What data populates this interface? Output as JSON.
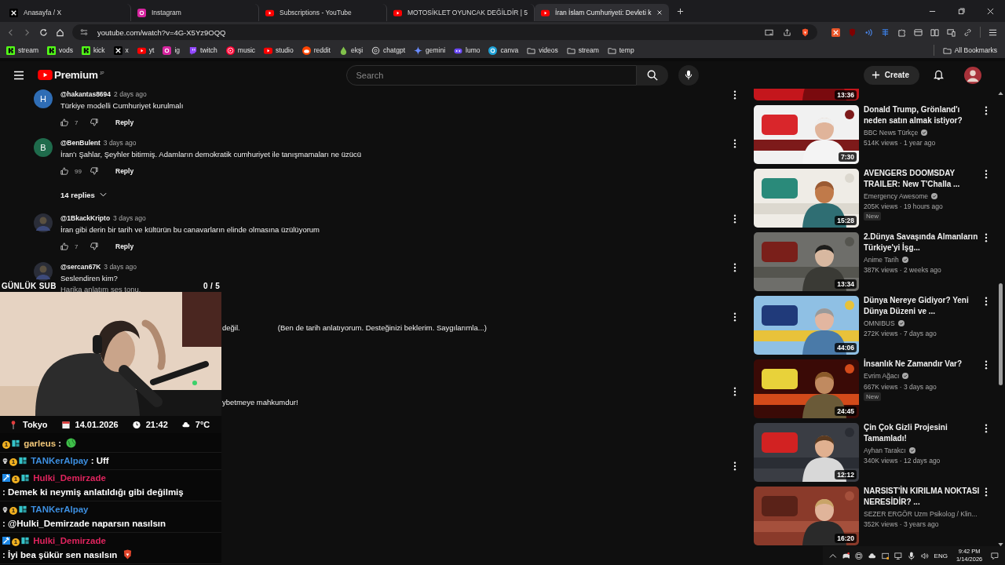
{
  "browser": {
    "tabs": [
      {
        "title": "Anasayfa / X",
        "kind": "x",
        "selected": false
      },
      {
        "title": "Instagram",
        "kind": "instagram",
        "selected": false
      },
      {
        "title": "Subscriptions - YouTube",
        "kind": "youtube",
        "selected": false
      },
      {
        "title": "MOTOSİKLET OYUNCAK DEĞİLDİR | 5",
        "kind": "youtube",
        "selected": false
      },
      {
        "title": "İran İslam Cumhuriyeti: Devleti k",
        "kind": "youtube",
        "selected": true
      }
    ],
    "address": "youtube.com/watch?v=4G-X5Yz9OQQ",
    "bookmarks": [
      {
        "label": "stream",
        "kind": "kick"
      },
      {
        "label": "vods",
        "kind": "kick"
      },
      {
        "label": "kick",
        "kind": "kick"
      },
      {
        "label": "x",
        "kind": "x"
      },
      {
        "label": "yt",
        "kind": "youtube"
      },
      {
        "label": "ig",
        "kind": "instagram"
      },
      {
        "label": "twitch",
        "kind": "twitch"
      },
      {
        "label": "music",
        "kind": "ytmusic"
      },
      {
        "label": "studio",
        "kind": "youtube"
      },
      {
        "label": "reddit",
        "kind": "reddit"
      },
      {
        "label": "ekşi",
        "kind": "drop"
      },
      {
        "label": "chatgpt",
        "kind": "openai"
      },
      {
        "label": "gemini",
        "kind": "gemini"
      },
      {
        "label": "lumo",
        "kind": "lumo"
      },
      {
        "label": "canva",
        "kind": "canva"
      },
      {
        "label": "videos",
        "kind": "folder"
      },
      {
        "label": "stream",
        "kind": "folder"
      },
      {
        "label": "temp",
        "kind": "folder"
      }
    ],
    "all_bookmarks": "All Bookmarks"
  },
  "header": {
    "logo": "Premium",
    "region": "JP",
    "search_placeholder": "Search",
    "create": "Create"
  },
  "comments": [
    {
      "kind": "comment",
      "avatar": {
        "kind": "letter",
        "letter": "H",
        "color": "#2f6db5"
      },
      "author": "@hakantas8694",
      "time": "2 days ago",
      "lines": [
        "Türkiye modelli Cumhuriyet kurulmalı"
      ],
      "likes": "7",
      "reply": "Reply"
    },
    {
      "kind": "comment",
      "avatar": {
        "kind": "letter",
        "letter": "B",
        "color": "#1f6b4c"
      },
      "author": "@BenBulent",
      "time": "3 days ago",
      "lines": [
        "İran'ı Şahlar, Şeyhler bitirmiş. Adamların demokratik cumhuriyet ile tanışmamaları ne üzücü"
      ],
      "likes": "99",
      "reply": "Reply",
      "replies": "14 replies"
    },
    {
      "kind": "comment",
      "avatar": {
        "kind": "picture"
      },
      "author": "@1BkackKripto",
      "time": "3 days ago",
      "lines": [
        "İran gibi derin bir tarih ve kültürün bu canavarların elinde olmasına üzülüyorum"
      ],
      "likes": "7",
      "reply": "Reply"
    },
    {
      "kind": "comment",
      "avatar": {
        "kind": "picture"
      },
      "author": "@sercan67K",
      "time": "3 days ago",
      "lines": [
        "Seslendiren kim?",
        "Harika anlatım ses tonu."
      ]
    },
    {
      "kind": "fragment",
      "parts": [
        "değil.",
        "(Ben de tarih anlatıyorum. Desteğinizi beklerim. Saygılarımla...)"
      ]
    },
    {
      "kind": "fragment",
      "parts": [
        "ybetmeye mahkumdur!"
      ]
    },
    {
      "kind": "covered"
    }
  ],
  "related": [
    {
      "kind": "partial",
      "duration": "13:36"
    },
    {
      "kind": "video",
      "title": "Donald Trump, Grönland'ı neden satın almak istiyor?",
      "channel": "BBC News Türkçe",
      "verified": true,
      "meta": "514K views · 1 year ago",
      "duration": "7:30"
    },
    {
      "kind": "video",
      "title": "AVENGERS DOOMSDAY TRAILER: New T'Challa ...",
      "channel": "Emergency Awesome",
      "verified": true,
      "meta": "205K views · 19 hours ago",
      "badge": "New",
      "duration": "15:28"
    },
    {
      "kind": "video",
      "title": "2.Dünya Savaşında Almanların Türkiye'yi İşg...",
      "channel": "Anime Tarih",
      "verified": true,
      "meta": "387K views · 2 weeks ago",
      "duration": "13:34"
    },
    {
      "kind": "video",
      "title": "Dünya Nereye Gidiyor? Yeni Dünya Düzeni ve ...",
      "channel": "OMNIBUS",
      "verified": true,
      "meta": "272K views · 7 days ago",
      "duration": "44:06"
    },
    {
      "kind": "video",
      "title": "İnsanlık Ne Zamandır Var?",
      "channel": "Evrim Ağacı",
      "verified": true,
      "meta": "667K views · 3 days ago",
      "badge": "New",
      "duration": "24:45"
    },
    {
      "kind": "video",
      "title": "Çin Çok Gizli Projesini Tamamladı!",
      "channel": "Ayhan Tarakcı",
      "verified": true,
      "meta": "340K views · 12 days ago",
      "duration": "12:12"
    },
    {
      "kind": "video",
      "title": "NARSIST'İN KIRILMA NOKTASI NERESİDİR? ...",
      "channel": "SEZER ERGÖR Uzm Psikolog / Klin...",
      "verified": false,
      "meta": "352K views · 3 years ago",
      "duration": "16:20"
    }
  ],
  "overlay": {
    "goal_label": "GÜNLÜK SUB",
    "goal_count": "0 / 5",
    "info": [
      {
        "kind": "location",
        "text": "Tokyo"
      },
      {
        "kind": "date",
        "text": "14.01.2026"
      },
      {
        "kind": "time",
        "text": "21:42"
      },
      {
        "kind": "weather",
        "text": "7°C"
      }
    ],
    "chat": [
      {
        "user": "garleus",
        "color": "#f2c879",
        "badges": [
          {
            "kind": "tier",
            "label": "1"
          },
          {
            "kind": "gift"
          }
        ],
        "message": ":",
        "emote": {
          "kind": "globe"
        }
      },
      {
        "user": "TANKerAlpay",
        "color": "#3d8fe0",
        "badges": [
          {
            "kind": "skull"
          },
          {
            "kind": "tier",
            "label": "1"
          },
          {
            "kind": "gift"
          }
        ],
        "message": ": Uff"
      },
      {
        "user": "Hulki_Demirzade",
        "color": "#e0245e",
        "badges": [
          {
            "kind": "mod"
          },
          {
            "kind": "tier",
            "label": "1"
          },
          {
            "kind": "gift"
          }
        ],
        "message": ": Demek ki neymiş anlatıldığı gibi değilmiş"
      },
      {
        "user": "TANKerAlpay",
        "color": "#3d8fe0",
        "badges": [
          {
            "kind": "skull"
          },
          {
            "kind": "tier",
            "label": "1"
          },
          {
            "kind": "gift"
          }
        ],
        "message": ": @Hulki_Demirzade naparsın nasılsın"
      },
      {
        "user": "Hulki_Demirzade",
        "color": "#e0245e",
        "badges": [
          {
            "kind": "mod"
          },
          {
            "kind": "tier",
            "label": "1"
          },
          {
            "kind": "gift"
          }
        ],
        "message": ": İyi bea şükür sen nasılsın",
        "emote": {
          "kind": "lion"
        }
      }
    ]
  },
  "taskbar": {
    "language": "ENG",
    "time": "9:42 PM",
    "date": "1/14/2026"
  }
}
